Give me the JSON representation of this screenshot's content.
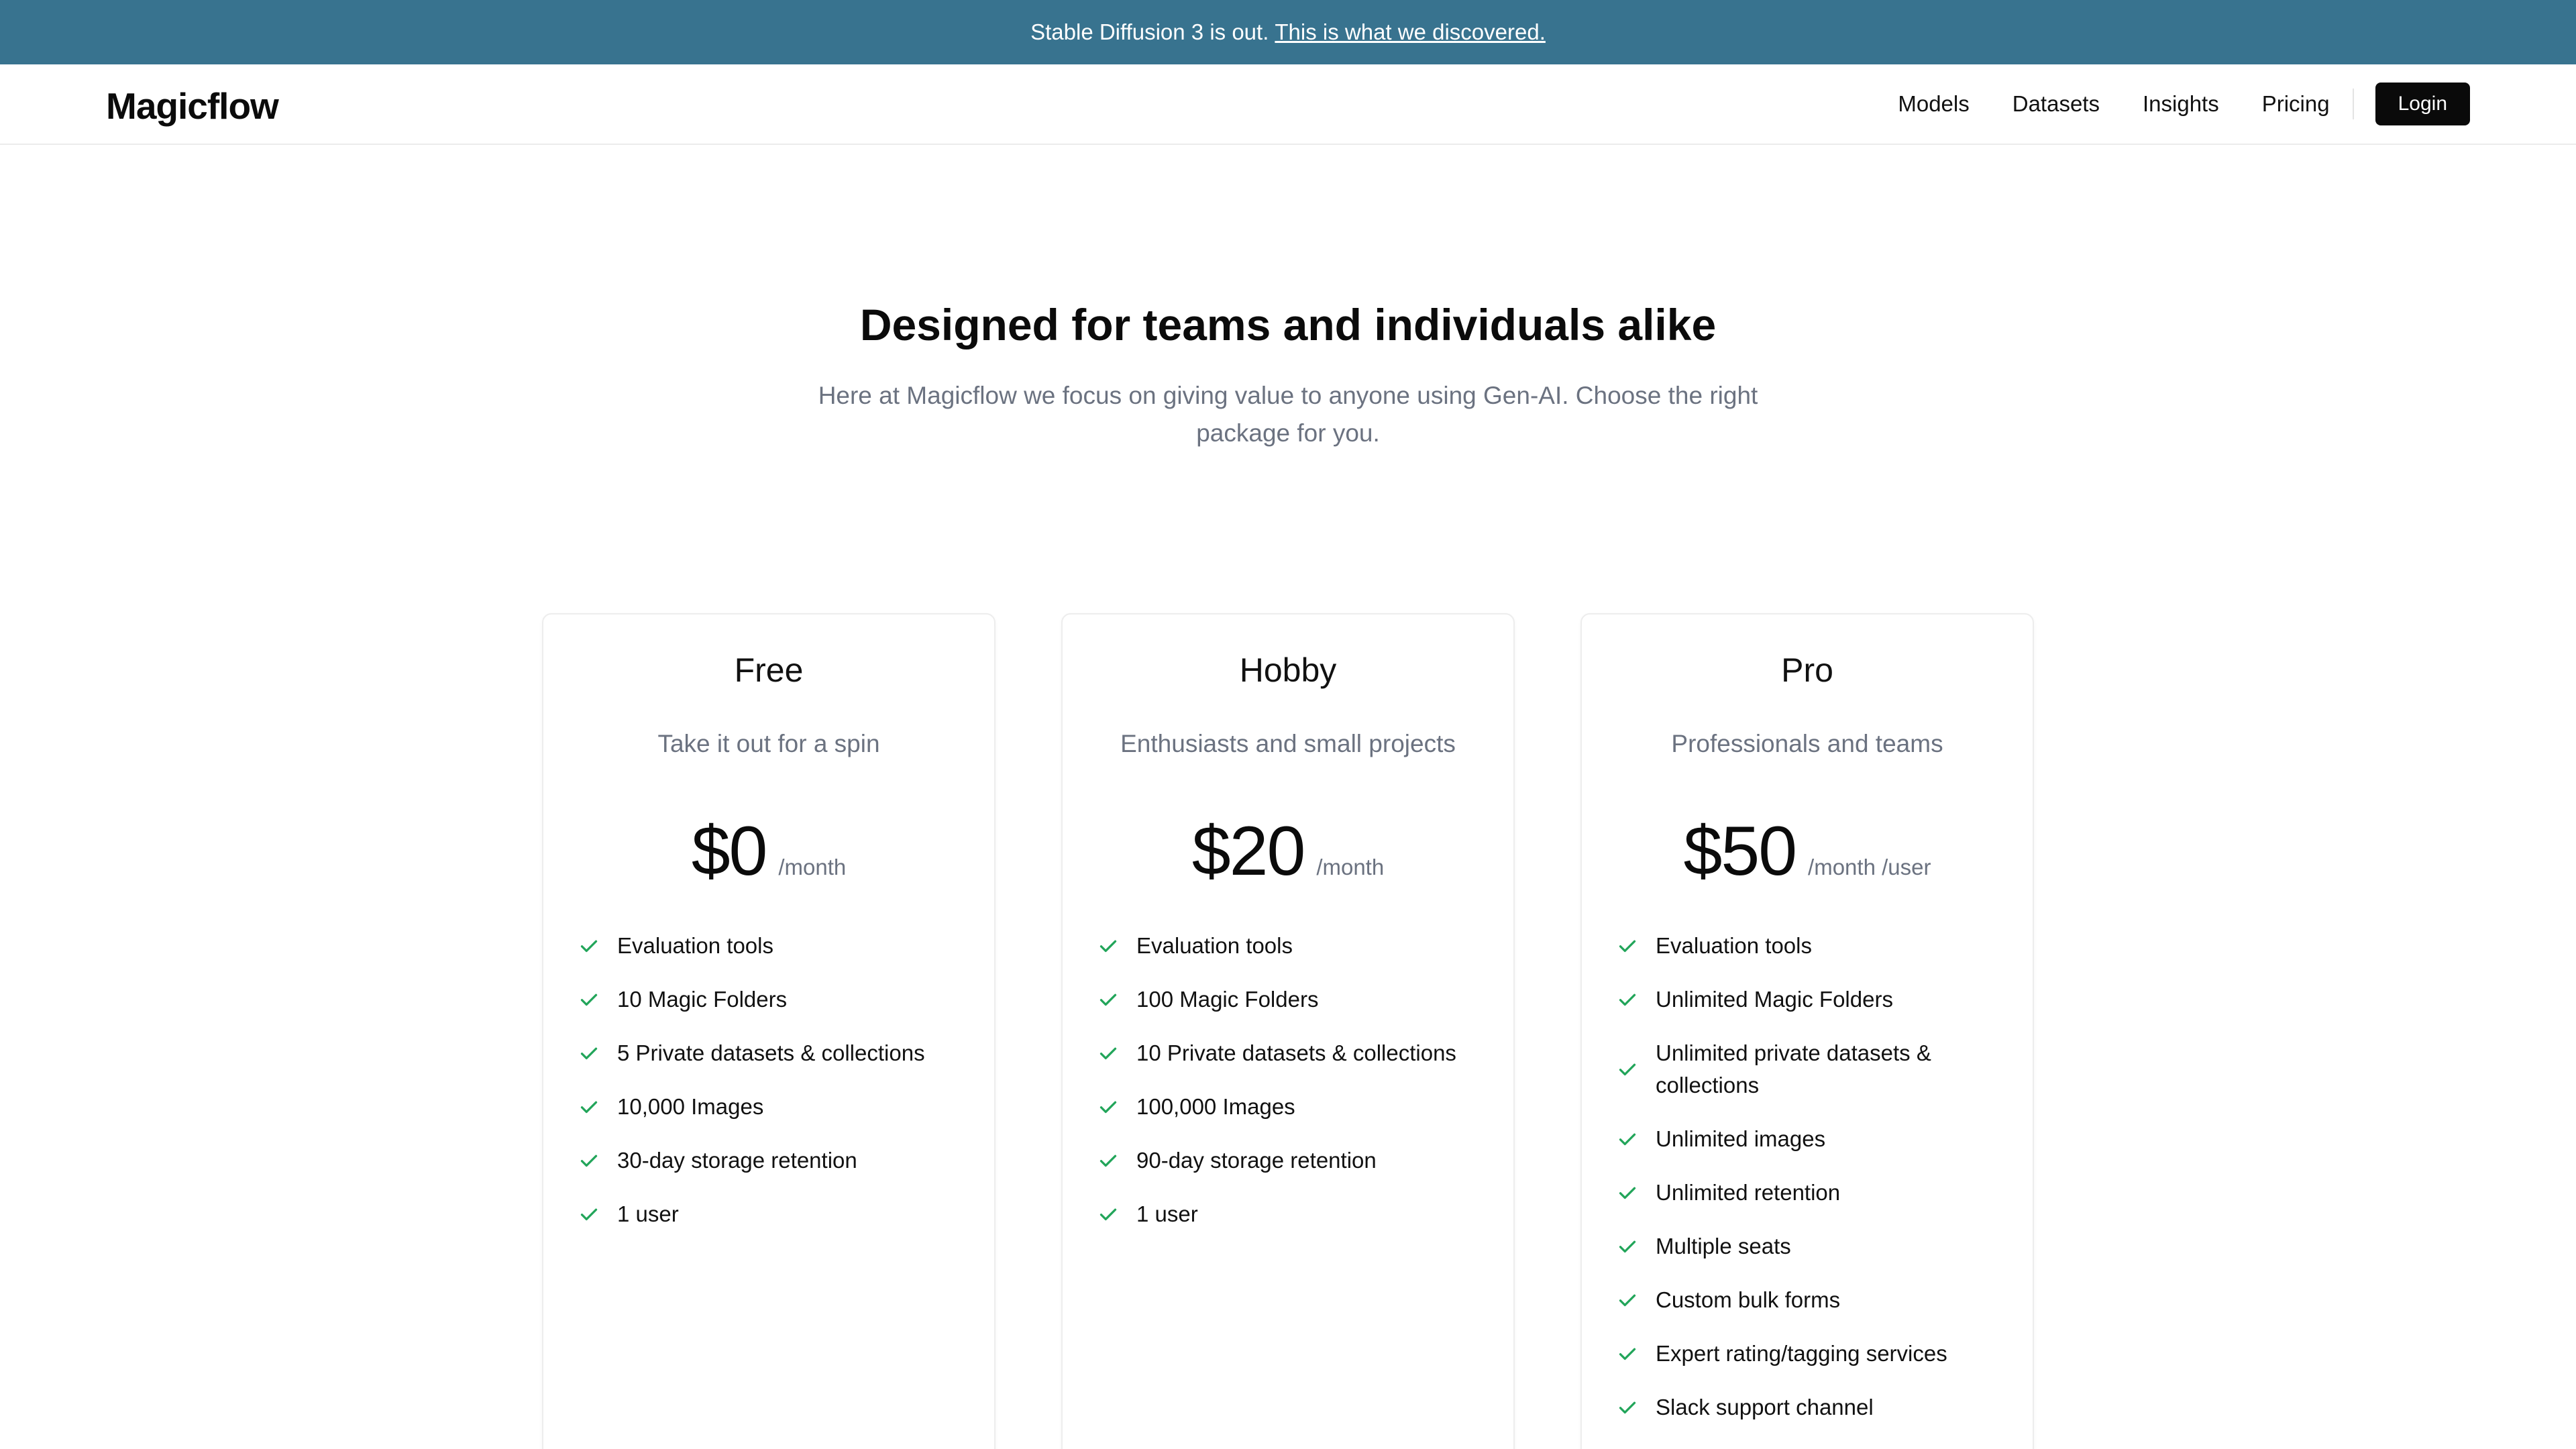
{
  "announcement": {
    "text": "Stable Diffusion 3 is out.",
    "link": "This is what we discovered."
  },
  "nav": {
    "logo": "Magicflow",
    "links": [
      "Models",
      "Datasets",
      "Insights",
      "Pricing"
    ],
    "login": "Login"
  },
  "hero": {
    "title": "Designed for teams and individuals alike",
    "subtitle": "Here at Magicflow we focus on giving value to anyone using Gen-AI. Choose the right package for you."
  },
  "colors": {
    "announcement_bg": "#38738f",
    "check": "#22a55a",
    "login_bg": "#0a0a0a"
  },
  "icons": {
    "feature": "check-icon"
  },
  "plans": [
    {
      "name": "Free",
      "tagline": "Take it out for a spin",
      "price": "$0",
      "period": "/month",
      "features": [
        "Evaluation tools",
        "10 Magic Folders",
        "5 Private datasets & collections",
        "10,000 Images",
        "30-day storage retention",
        "1 user"
      ]
    },
    {
      "name": "Hobby",
      "tagline": "Enthusiasts and small projects",
      "price": "$20",
      "period": "/month",
      "features": [
        "Evaluation tools",
        "100 Magic Folders",
        "10 Private datasets & collections",
        "100,000 Images",
        "90-day storage retention",
        "1 user"
      ]
    },
    {
      "name": "Pro",
      "tagline": "Professionals and teams",
      "price": "$50",
      "period": "/month /user",
      "features": [
        "Evaluation tools",
        "Unlimited Magic Folders",
        "Unlimited private datasets & collections",
        "Unlimited images",
        "Unlimited retention",
        "Multiple seats",
        "Custom bulk forms",
        "Expert rating/tagging services",
        "Slack support channel"
      ]
    }
  ]
}
